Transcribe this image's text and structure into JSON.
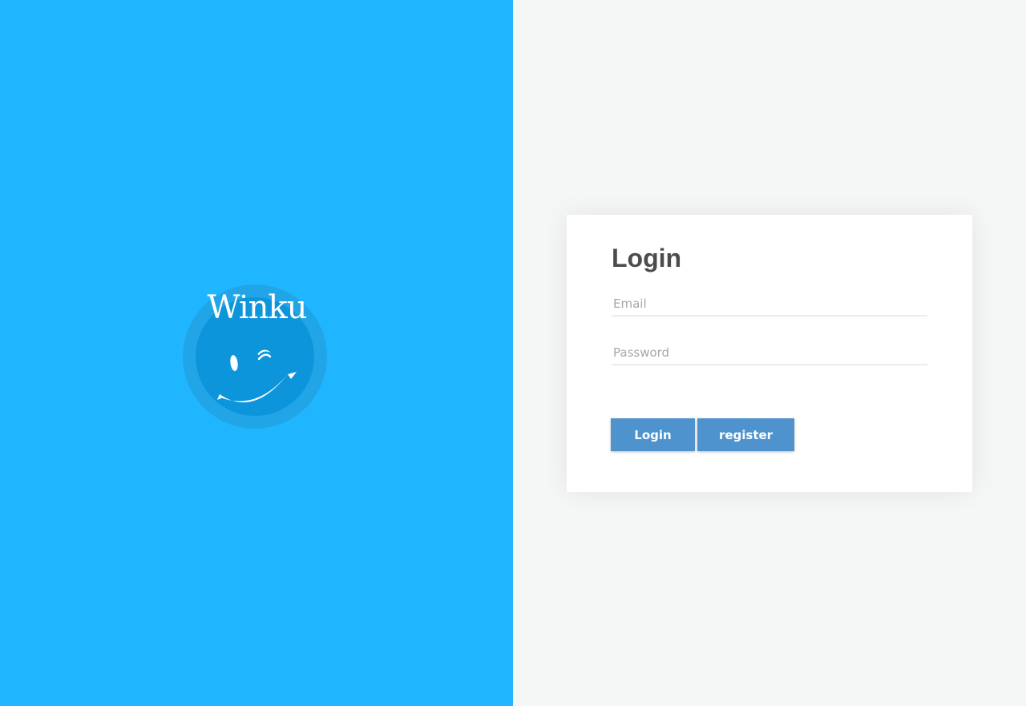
{
  "brand": {
    "name": "Winku",
    "icon": "winking-smiley-icon",
    "colors": {
      "panel": "#1fb6ff",
      "ring": "#22a5e6",
      "disc": "#0d95dc"
    }
  },
  "login": {
    "title": "Login",
    "email_placeholder": "Email",
    "email_value": "",
    "password_placeholder": "Password",
    "password_value": "",
    "login_button": "Login",
    "register_button": "register",
    "button_color": "#4e93cd"
  }
}
